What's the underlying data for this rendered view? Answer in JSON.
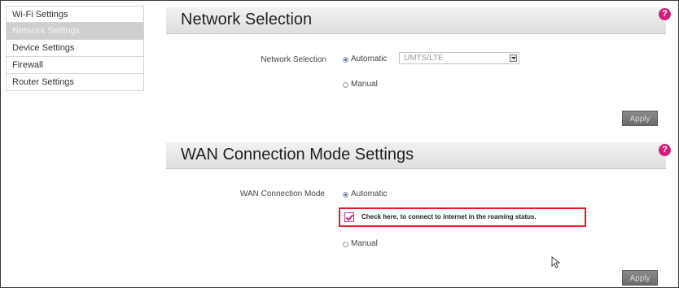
{
  "sidebar": {
    "items": [
      {
        "label": "Wi-Fi Settings"
      },
      {
        "label": "Network Settings"
      },
      {
        "label": "Device Settings"
      },
      {
        "label": "Firewall"
      },
      {
        "label": "Router Settings"
      }
    ]
  },
  "network_selection": {
    "title": "Network Selection",
    "field_label": "Network Selection",
    "automatic_label": "Automatic",
    "manual_label": "Manual",
    "selected_mode": "Automatic",
    "select_value": "UMTS/LTE",
    "apply_label": "Apply"
  },
  "wan_mode": {
    "title": "WAN Connection Mode Settings",
    "field_label": "WAN Connection Mode",
    "automatic_label": "Automatic",
    "roaming_text": "Check here, to connect to internet in the roaming status.",
    "roaming_checked": true,
    "manual_label": "Manual",
    "selected_mode": "Automatic",
    "apply_label": "Apply"
  },
  "colors": {
    "help_accent": "#d21e7a",
    "highlight_border": "#e21d2b",
    "radio_selected": "#2a67b0"
  },
  "icons": {
    "help": "help-icon",
    "dropdown": "chevron-down-icon",
    "cursor": "cursor-icon"
  }
}
